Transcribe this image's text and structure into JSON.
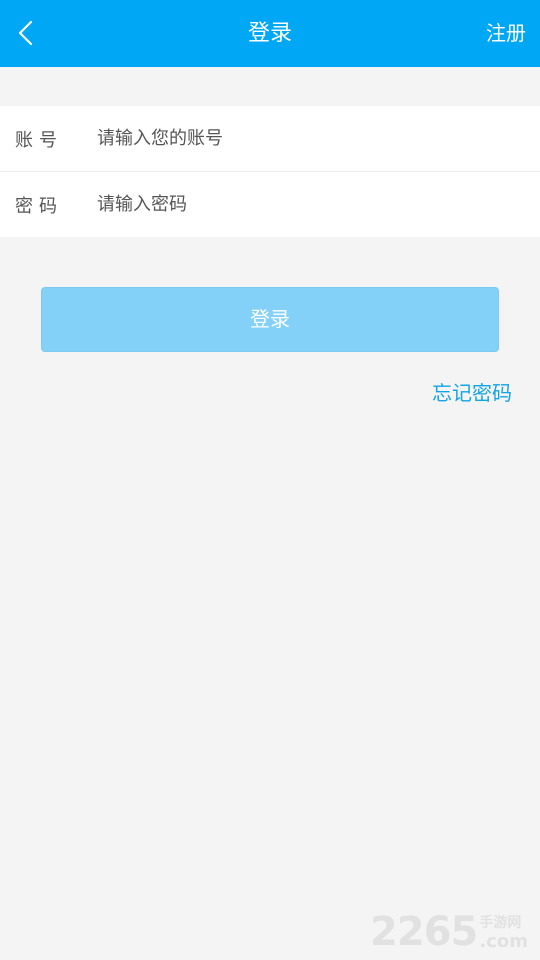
{
  "header": {
    "title": "登录",
    "register_label": "注册",
    "back_icon": "chevron-left-icon"
  },
  "form": {
    "account_label": "账号",
    "account_placeholder": "请输入您的账号",
    "account_value": "",
    "password_label": "密码",
    "password_placeholder": "请输入密码",
    "password_value": ""
  },
  "login_button_label": "登录",
  "forgot_password_label": "忘记密码",
  "watermark": {
    "number": "2265",
    "cn": "手游网",
    "com": ".com"
  },
  "colors": {
    "header_bg": "#00a7f5",
    "login_button_bg": "#83d1f9",
    "link": "#13a4e6",
    "page_bg": "#f4f4f4"
  }
}
